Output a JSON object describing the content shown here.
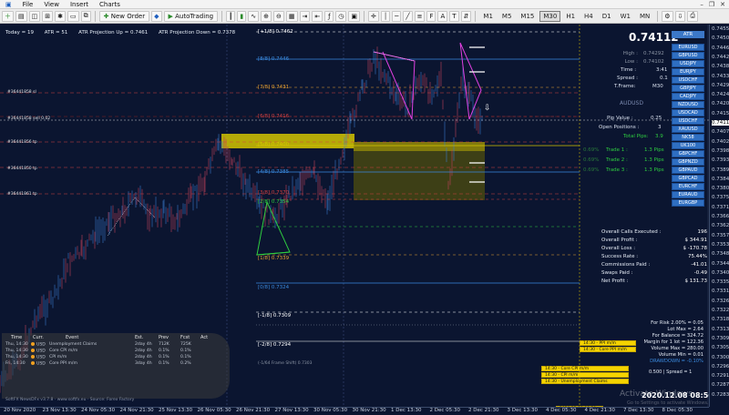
{
  "menu": {
    "items": [
      "File",
      "View",
      "Insert",
      "Charts"
    ]
  },
  "toolbar": {
    "new_order": "New Order",
    "autotrading": "AutoTrading",
    "timeframes": [
      "M1",
      "M5",
      "M15",
      "M30",
      "H1",
      "H4",
      "D1",
      "W1",
      "MN"
    ],
    "active_timeframe": "M30"
  },
  "info_line": {
    "today": "Today = 19",
    "atr": "ATR = 51",
    "proj_up": "ATR Projection Up = 0.7461",
    "proj_down": "ATR Projection Down = 0.7378"
  },
  "levels": [
    {
      "label": "[+1/8]  0.7462",
      "color": "#ffffff"
    },
    {
      "label": "[8/8]  0.7446",
      "color": "#3a8adf"
    },
    {
      "label": "[7/8]  0.7431",
      "color": "#e8a030"
    },
    {
      "label": "[6/8]  0.7416",
      "color": "#d04040"
    },
    {
      "label": "[5/8]  0.7400",
      "color": "#d4c400"
    },
    {
      "label": "[4/8]  0.7385",
      "color": "#3a8adf"
    },
    {
      "label": "[3/8]  0.7370",
      "color": "#d04040"
    },
    {
      "label": "[2/8]  0.7354",
      "color": "#2ecc40"
    },
    {
      "label": "[1/8]  0.7339",
      "color": "#e8a030"
    },
    {
      "label": "[0/8]  0.7324",
      "color": "#3a8adf"
    },
    {
      "label": "[-1/8]  0.7309",
      "color": "#ffffff"
    },
    {
      "label": "[-2/8]  0.7294",
      "color": "#ffffff"
    },
    {
      "label": "(-1/64 Frame Shift)  0.7303",
      "color": "#8a93a3"
    }
  ],
  "pair_tags": [
    "#36441858 sl",
    "#36441858 sell 0.02",
    "#36441856 tp",
    "#36441850 tp",
    "#36441861 tp"
  ],
  "price_axis": [
    "0.74550",
    "0.74505",
    "0.74460",
    "0.74420",
    "0.74380",
    "0.74335",
    "0.74290",
    "0.74245",
    "0.74200",
    "0.74155",
    "0.74112",
    "0.74070",
    "0.74025",
    "0.73980",
    "0.73935",
    "0.73890",
    "0.73845",
    "0.73800",
    "0.73755",
    "0.73710",
    "0.73665",
    "0.73620",
    "0.73575",
    "0.73530",
    "0.73485",
    "0.73440",
    "0.73400",
    "0.73355",
    "0.73310",
    "0.73265",
    "0.73220",
    "0.73180",
    "0.73135",
    "0.73090",
    "0.73050",
    "0.73005",
    "0.72960",
    "0.72915",
    "0.72870",
    "0.72830"
  ],
  "time_axis": [
    "20 Nov 2020",
    "23 Nov 13:30",
    "24 Nov 05:30",
    "24 Nov 21:30",
    "25 Nov 13:30",
    "26 Nov 05:30",
    "26 Nov 21:30",
    "27 Nov 13:30",
    "30 Nov 05:30",
    "30 Nov 21:30",
    "1 Dec 13:30",
    "2 Dec 05:30",
    "2 Dec 21:30",
    "3 Dec 13:30",
    "4 Dec 05:30",
    "4 Dec 21:30",
    "7 Dec 13:30",
    "8 Dec 05:30"
  ],
  "panel": {
    "price": "0.74112",
    "atr_button": "ATR",
    "high_label": "High :",
    "high": "0.74292",
    "low_label": "Low :",
    "low": "0.74102",
    "time_label": "Time :",
    "time": "3:41",
    "spread_label": "Spread :",
    "spread": "0.1",
    "tframe_label": "T.Frame:",
    "tframe": "M30",
    "pip_value_label": "Pip Value :",
    "pip_value": "0.25",
    "open_positions_label": "Open Positions :",
    "open_positions": "3",
    "total_pips_label": "Total Pips:",
    "total_pips": "3.9",
    "trades": [
      {
        "pct": "0.69%",
        "label": "Trade 1 :",
        "pips": "1.3 Pips"
      },
      {
        "pct": "0.69%",
        "label": "Trade 2 :",
        "pips": "1.3 Pips"
      },
      {
        "pct": "0.69%",
        "label": "Trade 3 :",
        "pips": "1.3 Pips"
      }
    ],
    "pairs": [
      "EURUSD",
      "GBPUSD",
      "USDJPY",
      "EURJPY",
      "USDCHF",
      "GBPJPY",
      "CADJPY",
      "AUDUSD",
      "NZDUSD",
      "USDCAD",
      "USDCHF",
      "XAUUSD",
      "NK58",
      "UK100",
      "GBPCHF",
      "GBPNZD",
      "GBPAUD",
      "GBPCAD",
      "EURCHF",
      "EURAUD",
      "EURGBP"
    ],
    "selected_pair": "AUDUSD"
  },
  "account": [
    {
      "label": "Overall Calls Executed :",
      "value": "196"
    },
    {
      "label": "Overall Profit :",
      "value": "$ 344.91"
    },
    {
      "label": "Overall Loss :",
      "value": "$ -170.78"
    },
    {
      "label": "Success Rate :",
      "value": "75.44%"
    },
    {
      "label": "Commissions Paid :",
      "value": "-41.01"
    },
    {
      "label": "Swaps Paid :",
      "value": "-0.49"
    },
    {
      "label": "Net Profit :",
      "value": "$ 131.73"
    }
  ],
  "risk": {
    "line1": "For Risk 2.00% = 0.05",
    "line2": "Lot Max = 2.64",
    "line3": "For Balance = 324.72",
    "line4": "Margin for 1 lot = 122.36",
    "line5": "Volume Max = 280.00",
    "line6": "Volume Min = 0.01",
    "drawdown": "DRAWDOWN = -0.10%",
    "spread_line": "0.500 | Spread = 1"
  },
  "news": {
    "headers": [
      "Time",
      "Curr.",
      "Event",
      "Est.",
      "Prev",
      "Fcst",
      "Act"
    ],
    "rows": [
      {
        "time": "Thu, 14:30",
        "curr": "USD",
        "event": "Unemployment Claims",
        "est": "2day 4h",
        "prev": "712K",
        "fcst": "725K",
        "act": ""
      },
      {
        "time": "Thu, 14:30",
        "curr": "USD",
        "event": "Core CPI m/m",
        "est": "2day 4h",
        "prev": "0.1%",
        "fcst": "0.1%",
        "act": ""
      },
      {
        "time": "Thu, 14:30",
        "curr": "USD",
        "event": "CPI m/m",
        "est": "2day 4h",
        "prev": "0.1%",
        "fcst": "0.1%",
        "act": ""
      },
      {
        "time": "Fri, 14:30",
        "curr": "USD",
        "event": "Core PPI m/m",
        "est": "3day 4h",
        "prev": "0.1%",
        "fcst": "0.2%",
        "act": ""
      }
    ],
    "footer": "SoftFX NewsDFx v3.7.8 · www.softfx.eu · Source: Forex Factory"
  },
  "events": [
    {
      "label": "14:30 - PPI m/m"
    },
    {
      "label": "14:30 - Core PPI m/m"
    },
    {
      "label": "14:30 - Core CPI m/m"
    },
    {
      "label": "14:30 - CPI m/m"
    },
    {
      "label": "14:30 - Unemployment Claims"
    },
    {
      "label": "2020.12.08 06:30"
    }
  ],
  "clock": "2020.12.08 08:56:19",
  "watermark": "Activate Windows",
  "watermark_sub": "Go to Settings to activate Windows."
}
